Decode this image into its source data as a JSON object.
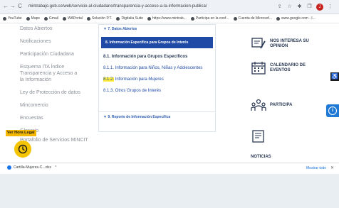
{
  "browser": {
    "url": "mintrabajo.gob.co/web/servicio-al-ciudadano/transparencia-y-acceso-a-la-informacion-publica/",
    "nav": {
      "back": "←",
      "forward": "→",
      "reload": "C",
      "home": "⌂"
    },
    "addr_icons": {
      "share": "⇪",
      "star": "☆",
      "ext": "✱",
      "tab": "❐",
      "avatar": "J",
      "menu": "⋮"
    },
    "bookmarks": [
      "YouTube",
      "Maps",
      "Gmail",
      "WAPortal",
      "Solución P.T.",
      "Digitalia Suite",
      "https://www.mintrab...",
      "Participa en la conf...",
      "Cuenta de Microsof...",
      "www.google.com - I..."
    ]
  },
  "left_menu": {
    "items": [
      "Datos Abiertos",
      "Notificaciones",
      "Participación Ciudadana",
      "Esquema ITA Índice Transparencia y Acceso a la Información",
      "Ley de Protección de datos",
      "Mincomercio",
      "Encuestas",
      "Glosario",
      "Portafolio de Servicios MINCIT"
    ],
    "hora_legal": "Ver Hora Legal"
  },
  "center": {
    "subhead1": "▼   7. Datos Abiertos",
    "bar_title": "8. Información Específica para Grupos de Interés",
    "link_title": "8.1. Información para Grupos Específicos",
    "link1": "8.1.1. Información para Niños, Niñas y Adolescentes",
    "link2_num": "8.1.2.",
    "link2_text": " Información para Mujeres",
    "link3": "8.1.3. Otros Grupos de Interés",
    "subhead2": "▼   9. Reporte de Información Específica"
  },
  "right": {
    "item1": "NOS INTERESA SU OPINIÓN",
    "item2": "CALENDARIO DE EVENTOS",
    "item3": "PARTICIPA",
    "noticias": "NOTICIAS"
  },
  "side_buttons": {
    "accessibility": "♿",
    "info": "i"
  },
  "downloads": {
    "file": "Cartilla-Mujeres-C...xlsx",
    "arrow": "^",
    "show_all": "Mostrar todo",
    "close": "✕"
  },
  "colors": {
    "accent": "#1f4aa6",
    "highlight": "#ffec3d",
    "hora": "#f5b800"
  }
}
